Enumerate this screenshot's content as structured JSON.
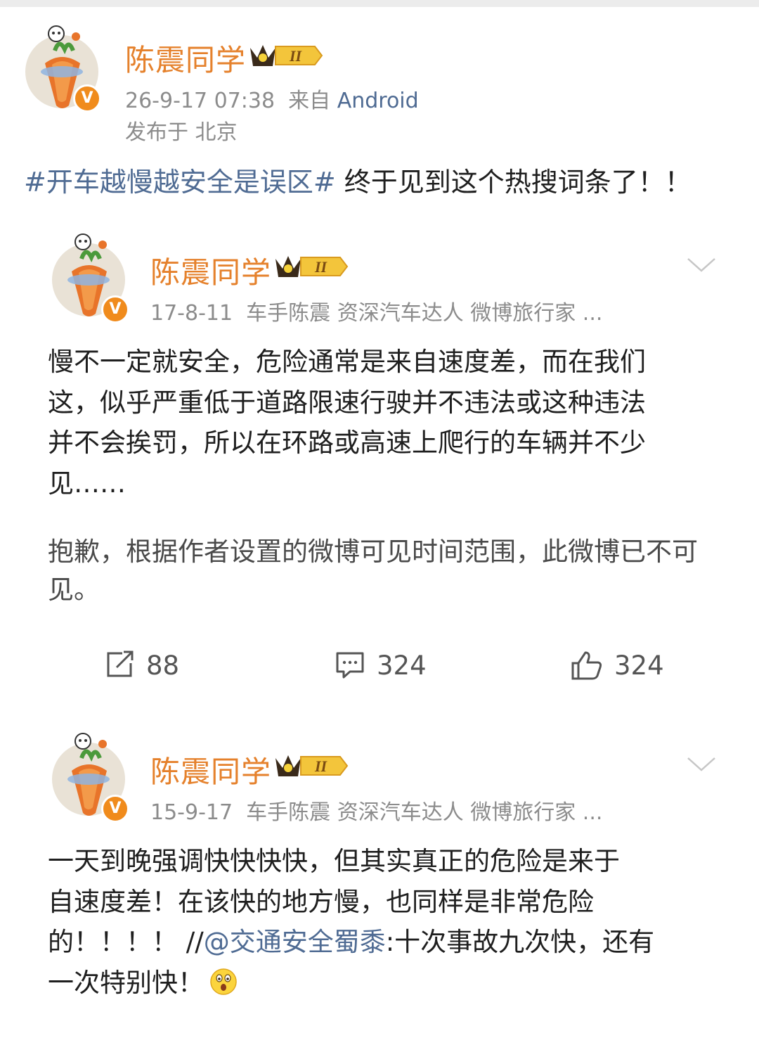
{
  "post": {
    "author": "陈震同学",
    "level_badge": "II",
    "timestamp": "26-9-17 07:38",
    "via_prefix": "来自",
    "source": "Android",
    "location": "发布于 北京",
    "topic": "#开车越慢越安全是误区#",
    "text": " 终于见到这个热搜词条了！！"
  },
  "repost1": {
    "author": "陈震同学",
    "level_badge": "II",
    "date": "17-8-11",
    "tags": "车手陈震 资深汽车达人 微博旅行家 ...",
    "lines": [
      "慢不一定就安全，危险通常是来自速度差，而在我们",
      "这，似乎严重低于道路限速行驶并不违法或这种违法",
      "并不会挨罚，所以在环路或高速上爬行的车辆并不少",
      "见……"
    ],
    "notice_lines": [
      "抱歉，根据作者设置的微博可见时间范围，此微博已不可",
      "见。"
    ],
    "reposts": "88",
    "comments": "324",
    "likes": "324"
  },
  "repost2": {
    "author": "陈震同学",
    "level_badge": "II",
    "date": "15-9-17",
    "tags": "车手陈震 资深汽车达人 微博旅行家 ...",
    "line1": "一天到晚强调快快快快，但其实真正的危险是来于",
    "line2": "自速度差！在该快的地方慢，也同样是非常危险",
    "line3_pre": "的！！！！ //",
    "mention": "@交通安全蜀黍",
    "line3_post": ":十次事故九次快，还有",
    "line4": "一次特别快！"
  },
  "colors": {
    "name_orange": "#e5812c",
    "link_blue": "#4f6b93",
    "meta_gray": "#8c8c8c",
    "verified_orange": "#f08b1c"
  },
  "icons": [
    "verified-icon",
    "crown-level-icon",
    "chevron-down-icon",
    "repost-icon",
    "comment-icon",
    "like-icon",
    "surprised-emoji-icon"
  ]
}
